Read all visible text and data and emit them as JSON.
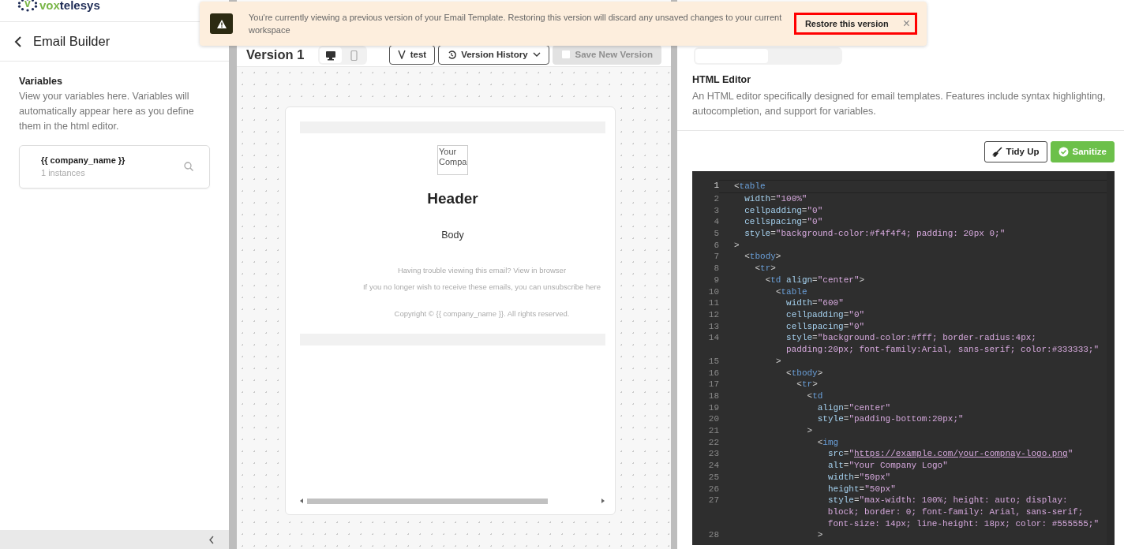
{
  "brand": {
    "letter": "v",
    "name_accent": "vox",
    "name_rest": "telesys"
  },
  "sidebar": {
    "title": "Email Builder",
    "section_title": "Variables",
    "section_text": "View your variables here. Variables will automatically appear here as you define them in the html editor.",
    "variables": [
      {
        "name": "{{ company_name }}",
        "count": "1 instances"
      }
    ]
  },
  "alert": {
    "message": "You're currently viewing a previous version of your Email Template. Restoring this version will discard any unsaved changes to your current workspace",
    "action": "Restore this version",
    "close": "×"
  },
  "toolbar": {
    "title": "Version 1",
    "views": [
      {
        "kind": "desktop",
        "selected": true
      },
      {
        "kind": "mobile",
        "selected": false
      }
    ],
    "buttons": [
      {
        "kind": "test",
        "label": "test",
        "disabled": false
      },
      {
        "kind": "history",
        "label": "Version History",
        "disabled": false
      },
      {
        "kind": "save",
        "label": "Save New Version",
        "disabled": true
      }
    ]
  },
  "preview": {
    "logo_alt": [
      "Your",
      "Compa"
    ],
    "header": "Header",
    "body": "Body",
    "footer": [
      {
        "text": "Having trouble viewing this email?",
        "link": "View in browser"
      },
      {
        "text": "If you no longer wish to receive these emails, you can",
        "link": "unsubscribe here"
      }
    ],
    "copyright": "Copyright © {{ company_name }}. All rights reserved."
  },
  "editor": {
    "title": "HTML Editor",
    "description": "An HTML editor specifically designed for email templates. Features include syntax highlighting, autocompletion, and support for variables.",
    "buttons": [
      {
        "kind": "tidy",
        "label": "Tidy Up"
      },
      {
        "kind": "sanitize",
        "label": "Sanitize"
      }
    ],
    "lines": [
      {
        "number": "1",
        "rows": [
          "<table"
        ],
        "active": true
      },
      {
        "number": "2",
        "rows": [
          "  width=\"100%\""
        ],
        "active": false
      },
      {
        "number": "3",
        "rows": [
          "  cellpadding=\"0\""
        ],
        "active": false
      },
      {
        "number": "4",
        "rows": [
          "  cellspacing=\"0\""
        ],
        "active": false
      },
      {
        "number": "5",
        "rows": [
          "  style=\"background-color:#f4f4f4; padding: 20px 0;\""
        ],
        "active": false
      },
      {
        "number": "6",
        "rows": [
          ">"
        ],
        "active": false
      },
      {
        "number": "7",
        "rows": [
          "  <tbody>"
        ],
        "active": false
      },
      {
        "number": "8",
        "rows": [
          "    <tr>"
        ],
        "active": false
      },
      {
        "number": "9",
        "rows": [
          "      <td align=\"center\">"
        ],
        "active": false
      },
      {
        "number": "10",
        "rows": [
          "        <table"
        ],
        "active": false
      },
      {
        "number": "11",
        "rows": [
          "          width=\"600\""
        ],
        "active": false
      },
      {
        "number": "12",
        "rows": [
          "          cellpadding=\"0\""
        ],
        "active": false
      },
      {
        "number": "13",
        "rows": [
          "          cellspacing=\"0\""
        ],
        "active": false
      },
      {
        "number": "14",
        "rows": [
          "          style=\"background-color:#fff; border-radius:4px;",
          "          padding:20px; font-family:Arial, sans-serif; color:#333333;\""
        ],
        "active": false
      },
      {
        "number": "15",
        "rows": [
          "        >"
        ],
        "active": false
      },
      {
        "number": "16",
        "rows": [
          "          <tbody>"
        ],
        "active": false
      },
      {
        "number": "17",
        "rows": [
          "            <tr>"
        ],
        "active": false
      },
      {
        "number": "18",
        "rows": [
          "              <td"
        ],
        "active": false
      },
      {
        "number": "19",
        "rows": [
          "                align=\"center\""
        ],
        "active": false
      },
      {
        "number": "20",
        "rows": [
          "                style=\"padding-bottom:20px;\""
        ],
        "active": false
      },
      {
        "number": "21",
        "rows": [
          "              >"
        ],
        "active": false
      },
      {
        "number": "22",
        "rows": [
          "                <img"
        ],
        "active": false
      },
      {
        "number": "23",
        "rows": [
          "                  src=\"https://example.com/your-compnay-logo.png\""
        ],
        "active": false,
        "link": true
      },
      {
        "number": "24",
        "rows": [
          "                  alt=\"Your Company Logo\""
        ],
        "active": false
      },
      {
        "number": "25",
        "rows": [
          "                  width=\"50px\""
        ],
        "active": false
      },
      {
        "number": "26",
        "rows": [
          "                  height=\"50px\""
        ],
        "active": false
      },
      {
        "number": "27",
        "rows": [
          "                  style=\"max-width: 100%; height: auto; display:",
          "                  block; border: 0; font-family: Arial, sans-serif;",
          "                  font-size: 14px; line-height: 18px; color: #555555;\""
        ],
        "active": false
      },
      {
        "number": "28",
        "rows": [
          "                >"
        ],
        "active": false
      }
    ]
  }
}
